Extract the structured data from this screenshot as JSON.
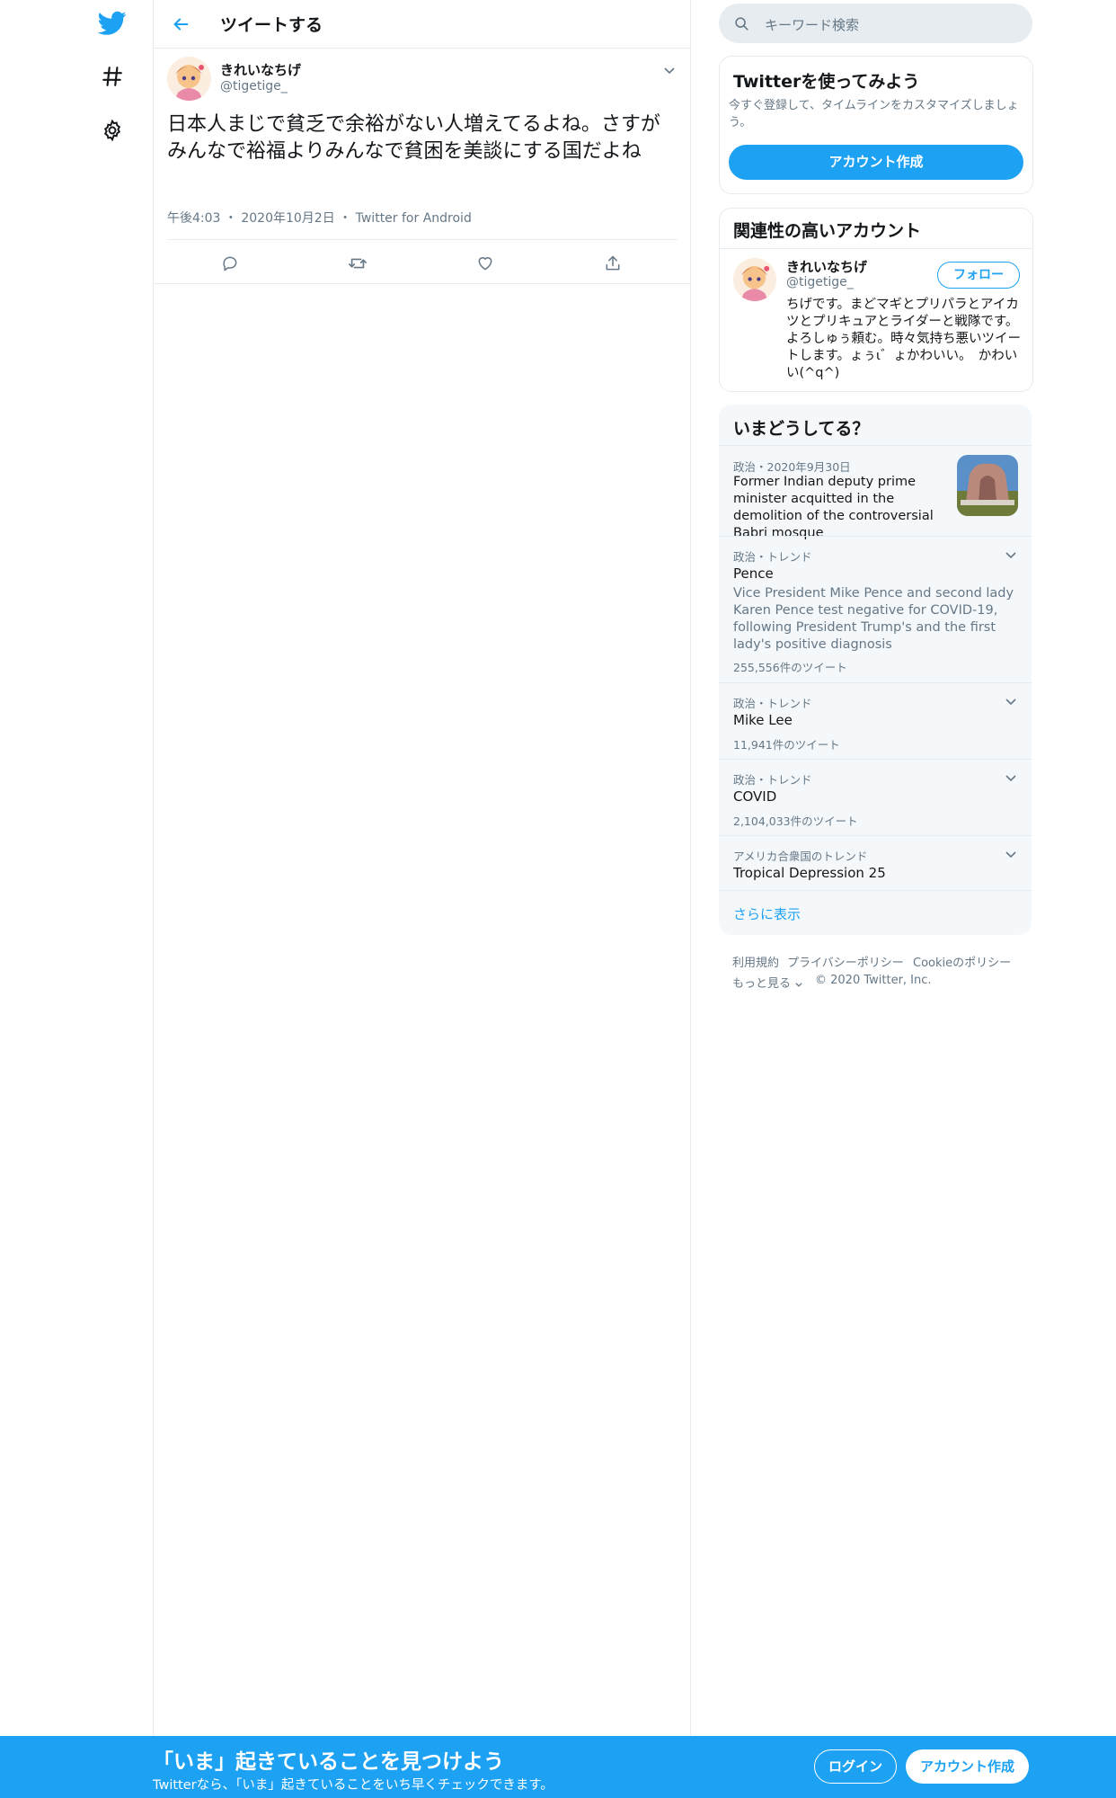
{
  "nav": {
    "icons": [
      "twitter-bird-icon",
      "hashtag-icon",
      "settings-gear-icon"
    ]
  },
  "header": {
    "title": "ツイートする"
  },
  "tweet": {
    "author_name": "きれいなちげ",
    "author_handle": "@tigetige_",
    "text": "日本人まじで貧乏で余裕がない人増えてるよね。さすがみんなで裕福よりみんなで貧困を美談にする国だよね",
    "time": "午後4:03",
    "date": "2020年10月2日",
    "source": "Twitter for Android",
    "actions": [
      "reply-icon",
      "retweet-icon",
      "like-icon",
      "share-icon"
    ]
  },
  "search": {
    "placeholder": "キーワード検索"
  },
  "signup_card": {
    "title": "Twitterを使ってみよう",
    "description": "今すぐ登録して、タイムラインをカスタマイズしましょう。",
    "button": "アカウント作成"
  },
  "related": {
    "title": "関連性の高いアカウント",
    "name": "きれいなちげ",
    "handle": "@tigetige_",
    "follow": "フォロー",
    "bio": "ちげです。まどマギとプリパラとアイカツとプリキュアとライダーと戦隊です。よろしゅぅ頼む。時々気持ち悪いツイートします。ょぅι゛ょかわいい。　かわいい(^q^)"
  },
  "trends": {
    "title": "いまどうしてる？",
    "items": [
      {
        "category": "政治・2020年9月30日",
        "name": "Former Indian deputy prime minister acquitted in the demolition of the controversial Babri mosque",
        "has_image": true
      },
      {
        "category": "政治・トレンド",
        "name": "Pence",
        "desc": "Vice President Mike Pence and second lady Karen Pence test negative for COVID-19, following President Trump's and the first lady's positive diagnosis",
        "count": "255,556件のツイート"
      },
      {
        "category": "政治・トレンド",
        "name": "Mike Lee",
        "count": "11,941件のツイート"
      },
      {
        "category": "政治・トレンド",
        "name": "COVID",
        "count": "2,104,033件のツイート"
      },
      {
        "category": "アメリカ合衆国のトレンド",
        "name": "Tropical Depression 25"
      }
    ],
    "show_more": "さらに表示"
  },
  "footer": {
    "terms": "利用規約",
    "privacy": "プライバシーポリシー",
    "cookie": "Cookieのポリシー",
    "more": "もっと見る",
    "copyright": "© 2020 Twitter, Inc."
  },
  "bottom_bar": {
    "title": "「いま」起きていることを見つけよう",
    "subtitle": "Twitterなら、「いま」起きていることをいち早くチェックできます。",
    "login": "ログイン",
    "signup": "アカウント作成"
  },
  "colors": {
    "brand": "#1da1f2",
    "text": "#14171a",
    "muted": "#657786",
    "border": "#e6ecf0",
    "panel": "#f5f8fa"
  }
}
